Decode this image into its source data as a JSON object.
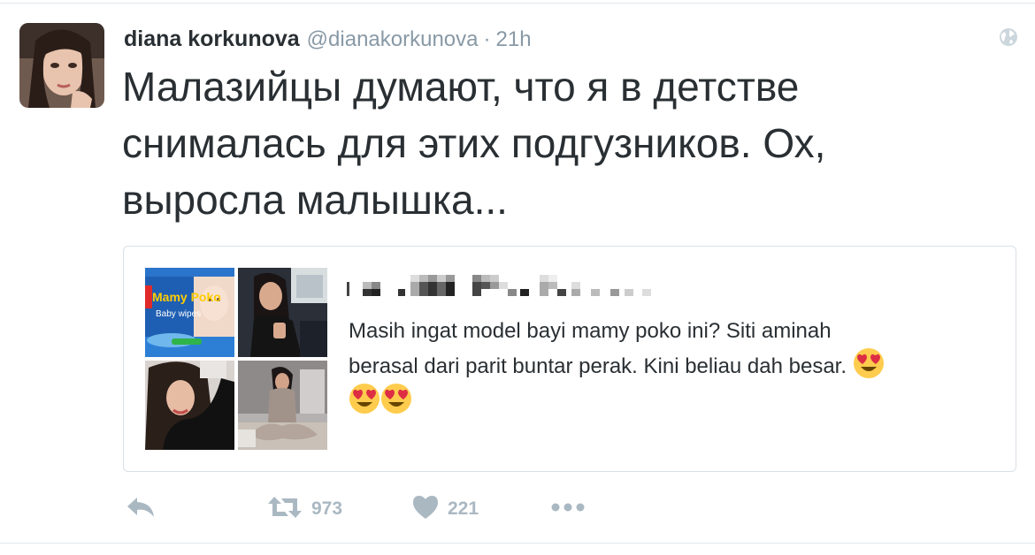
{
  "tweet": {
    "fullname": "diana korkunova",
    "username": "@dianakorkunova",
    "separator": "·",
    "time": "21h",
    "text_lines": [
      "Малазийцы думают, что я в детстве",
      "снималась для этих подгузников. Ох,",
      "выросла малышка..."
    ]
  },
  "quote": {
    "text_lines": [
      "Masih ingat model bayi mamy poko ini? Siti aminah",
      "berasal dari parit buntar perak. Kini beliau dah besar."
    ],
    "product_text": {
      "brand": "Mamy Poko",
      "line": "Baby wipes"
    }
  },
  "actions": {
    "retweet_count": "973",
    "like_count": "221"
  },
  "icons": {
    "globe": "globe-icon",
    "reply": "reply-icon",
    "retweet": "retweet-icon",
    "like": "heart-icon",
    "more": "more-icon",
    "emoji": "heart-eyes-emoji"
  },
  "colors": {
    "text": "#292f33",
    "meta": "#8899a6",
    "action": "#aab8c2",
    "border": "#e1e8ed"
  }
}
